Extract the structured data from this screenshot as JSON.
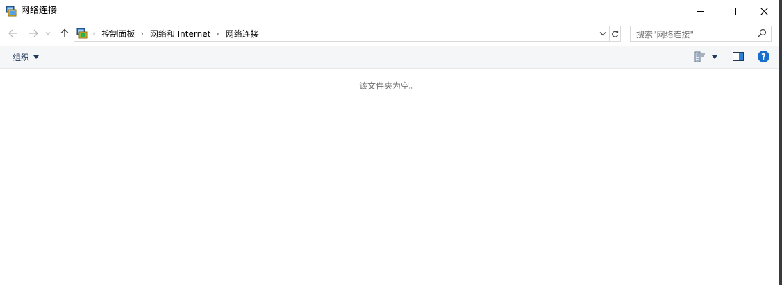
{
  "window": {
    "title": "网络连接",
    "icon": "network-connections-icon"
  },
  "controls": {
    "minimize": "minimize-icon",
    "maximize": "maximize-icon",
    "close": "close-icon"
  },
  "nav": {
    "back": "back-arrow-icon",
    "forward": "forward-arrow-icon",
    "recent": "chevron-down-icon",
    "up": "up-arrow-icon"
  },
  "address": {
    "breadcrumbs": [
      {
        "label": "控制面板"
      },
      {
        "label": "网络和 Internet"
      },
      {
        "label": "网络连接"
      }
    ]
  },
  "search": {
    "placeholder": "搜索\"网络连接\""
  },
  "toolbar": {
    "organize": "组织"
  },
  "content": {
    "empty_message": "该文件夹为空。"
  },
  "colors": {
    "accent": "#1a6ecb",
    "command_bar": "#f5f6f7",
    "link_text": "#1e395b"
  }
}
